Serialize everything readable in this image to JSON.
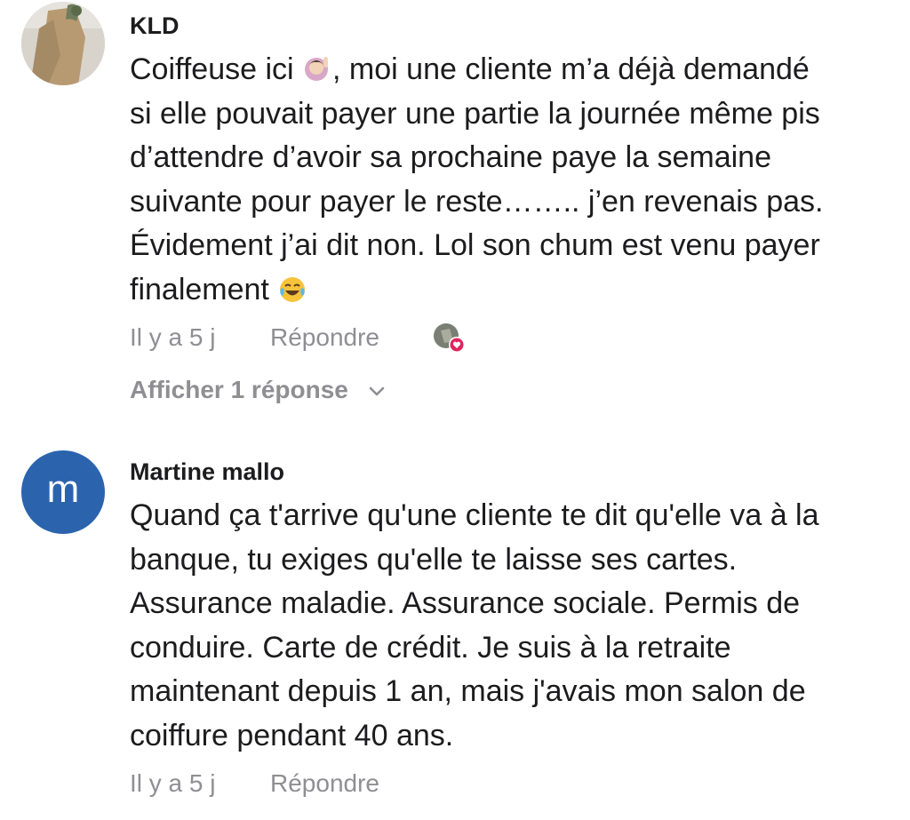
{
  "comments": [
    {
      "author": "KLD",
      "avatar_icon": "user-photo-icon",
      "lines": [
        ", moi une cliente m’a déjà demandé",
        "si elle pouvait payer une partie la journée même pis",
        "d’attendre d’avoir sa prochaine paye la semaine",
        "suivante pour payer le reste…….. j’en revenais pas.",
        "Évidement j’ai dit non. Lol son chum est venu payer",
        "finalement"
      ],
      "line1_prefix": "Coiffeuse ici",
      "emoji_1": "raising-hand-emoji-icon",
      "emoji_2": "tears-of-joy-emoji-icon",
      "timestamp": "Il y a 5 j",
      "reply_label": "Répondre",
      "reaction_icon": "author-liked-heart-icon",
      "show_replies_label": "Afficher 1 réponse"
    },
    {
      "author": "Martine mallo",
      "avatar_letter": "m",
      "avatar_color": "#2b63ad",
      "lines": [
        "Quand ça t'arrive qu'une cliente te dit qu'elle va à la",
        "banque, tu exiges qu'elle te laisse ses cartes.",
        "Assurance maladie. Assurance sociale. Permis de",
        "conduire. Carte de crédit. Je suis à la retraite",
        "maintenant depuis 1 an, mais j'avais mon salon de",
        "coiffure pendant 40 ans."
      ],
      "timestamp": "Il y a 5 j",
      "reply_label": "Répondre"
    }
  ],
  "colors": {
    "text": "#1c1c1e",
    "muted": "#8e8e93",
    "accent_heart": "#e0245e"
  }
}
